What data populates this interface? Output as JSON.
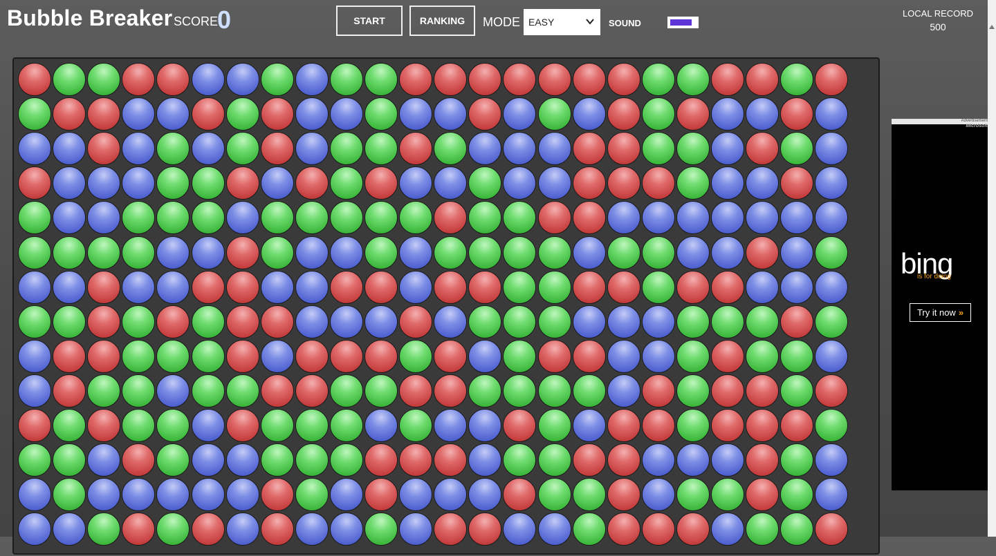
{
  "header": {
    "title": "Bubble Breaker",
    "score_label": "SCORE",
    "score_value": "0",
    "start_label": "START",
    "ranking_label": "RANKING",
    "mode_label": "MODE",
    "mode_selected": "EASY",
    "sound_label": "SOUND",
    "sound_on": true,
    "record_label": "LOCAL RECORD",
    "record_value": "500"
  },
  "colors": {
    "r": "#d9534f",
    "g": "#4cc94c",
    "b": "#5566d8",
    "toggle_accent": "#5e35d6"
  },
  "board": {
    "rows": [
      "rggrrbbgbggrrrrrrrggrrgr",
      "grrbbrgrbbgbbrbgbrgrbbrb",
      "bbrbgbgrbggrgbbbrrggbrgb",
      "rbbbggrbrgrbbgbbrrrgbbrb",
      "gbbgggbgggggrggrrbbbbbbb",
      "ggggbbrgbbgbggggbggbbrbg",
      "bbrbbrrbbrrbrrggrrgrrbbb",
      "ggrgrgrrbbbrbgggbbbgggrg",
      "brrgggrbrrrgrbgrrbbgrggb",
      "brggbggrrggrrggggbrgrrgr",
      "rgrggbrgggbgbbrgbrrgrrrg",
      "ggbrgbbgggrrrbggrrbbbrgb",
      "bgbbbbbrgbrbbbrggrbggrgb",
      "bbgrgrbrbbgbrrbbgrrrbggr"
    ]
  },
  "ad": {
    "small_text": "Advertisement",
    "brand_text": "Microsoft",
    "logo_text": "bing",
    "tagline": "is for doing",
    "cta_label": "Try it now",
    "cta_arrow": "»"
  }
}
